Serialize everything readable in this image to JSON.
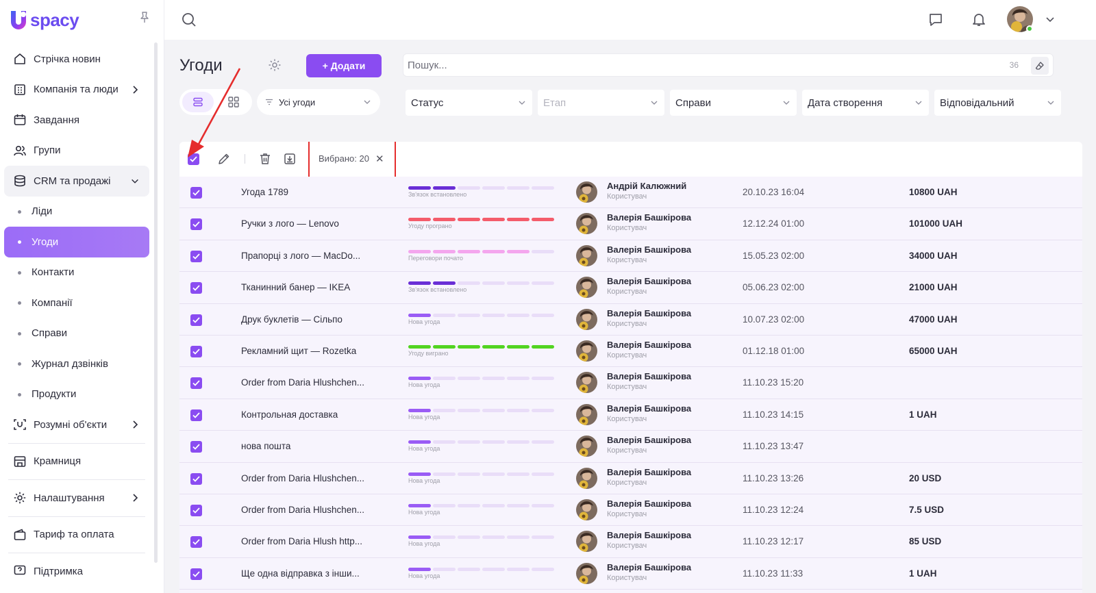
{
  "app": {
    "logo_text": "spacy",
    "logo_letter": "U"
  },
  "sidebar": {
    "items": [
      {
        "label": "Стрічка новин",
        "icon": "home-icon",
        "chevron": false
      },
      {
        "label": "Компанія та люди",
        "icon": "company-icon",
        "chevron": true
      },
      {
        "label": "Завдання",
        "icon": "calendar-icon",
        "chevron": false
      },
      {
        "label": "Групи",
        "icon": "groups-icon",
        "chevron": false
      },
      {
        "label": "CRM та продажі",
        "icon": "crm-icon",
        "chevron": true,
        "open": true
      }
    ],
    "sub_items": [
      {
        "label": "Ліди",
        "active": false
      },
      {
        "label": "Угоди",
        "active": true
      },
      {
        "label": "Контакти",
        "active": false
      },
      {
        "label": "Компанії",
        "active": false
      },
      {
        "label": "Справи",
        "active": false
      },
      {
        "label": "Журнал дзвінків",
        "active": false
      },
      {
        "label": "Продукти",
        "active": false
      }
    ],
    "bottom_items": [
      {
        "label": "Розумні об'єкти",
        "icon": "smart-objects-icon",
        "chevron": true
      },
      {
        "label": "Крамниця",
        "icon": "store-icon",
        "chevron": false
      },
      {
        "label": "Налаштування",
        "icon": "settings-icon",
        "chevron": true
      },
      {
        "label": "Тариф та оплата",
        "icon": "wallet-icon",
        "chevron": false
      },
      {
        "label": "Підтримка",
        "icon": "support-icon",
        "chevron": false
      }
    ]
  },
  "header": {
    "page_title": "Угоди",
    "add_button": "+ Додати",
    "search_placeholder": "Пошук...",
    "search_count": "36",
    "deals_filter": "Усі угоди",
    "filters": [
      "Статус",
      "Етап",
      "Справи",
      "Дата створення",
      "Відповідальний"
    ]
  },
  "toolbar": {
    "selected_text": "Вибрано: 20",
    "clear_symbol": "✕"
  },
  "colors": {
    "accent": "#8a4cf1",
    "stage_connected": "#6a2fd6",
    "stage_lost": "#f45c6b",
    "stage_negotiation": "#f4a6ee",
    "stage_new": "#9a5cf5",
    "stage_won": "#52d421",
    "annotation_red": "#e52d2d"
  },
  "deals": [
    {
      "name": "Угода 1789",
      "stage_label": "Зв'язок встановлено",
      "stage_kind": "connected",
      "stage_filled": 2,
      "owner": "Андрій Калюжний",
      "role": "Користувач",
      "date": "20.10.23 16:04",
      "amount": "10800 UAH"
    },
    {
      "name": "Ручки з лого — Lenovo",
      "stage_label": "Угоду програно",
      "stage_kind": "lost",
      "stage_filled": 6,
      "owner": "Валерія Башкірова",
      "role": "Користувач",
      "date": "12.12.24 01:00",
      "amount": "101000 UAH"
    },
    {
      "name": "Прапорці з лого — MacDo...",
      "stage_label": "Переговори почато",
      "stage_kind": "negotiation",
      "stage_filled": 5,
      "owner": "Валерія Башкірова",
      "role": "Користувач",
      "date": "15.05.23 02:00",
      "amount": "34000 UAH"
    },
    {
      "name": "Тканинний банер — IKEA",
      "stage_label": "Зв'язок встановлено",
      "stage_kind": "connected",
      "stage_filled": 2,
      "owner": "Валерія Башкірова",
      "role": "Користувач",
      "date": "05.06.23 02:00",
      "amount": "21000 UAH"
    },
    {
      "name": "Друк буклетів — Сільпо",
      "stage_label": "Нова угода",
      "stage_kind": "new",
      "stage_filled": 1,
      "owner": "Валерія Башкірова",
      "role": "Користувач",
      "date": "10.07.23 02:00",
      "amount": "47000 UAH"
    },
    {
      "name": "Рекламний щит — Rozetka",
      "stage_label": "Угоду виграно",
      "stage_kind": "won",
      "stage_filled": 6,
      "owner": "Валерія Башкірова",
      "role": "Користувач",
      "date": "01.12.18 01:00",
      "amount": "65000 UAH"
    },
    {
      "name": "Order from Daria Hlushchen...",
      "stage_label": "Нова угода",
      "stage_kind": "new",
      "stage_filled": 1,
      "owner": "Валерія Башкірова",
      "role": "Користувач",
      "date": "11.10.23 15:20",
      "amount": ""
    },
    {
      "name": "Контрольная доставка",
      "stage_label": "Нова угода",
      "stage_kind": "new",
      "stage_filled": 1,
      "owner": "Валерія Башкірова",
      "role": "Користувач",
      "date": "11.10.23 14:15",
      "amount": "1 UAH"
    },
    {
      "name": "нова пошта",
      "stage_label": "Нова угода",
      "stage_kind": "new",
      "stage_filled": 1,
      "owner": "Валерія Башкірова",
      "role": "Користувач",
      "date": "11.10.23 13:47",
      "amount": ""
    },
    {
      "name": "Order from Daria Hlushchen...",
      "stage_label": "Нова угода",
      "stage_kind": "new",
      "stage_filled": 1,
      "owner": "Валерія Башкірова",
      "role": "Користувач",
      "date": "11.10.23 13:26",
      "amount": "20 USD"
    },
    {
      "name": "Order from Daria Hlushchen...",
      "stage_label": "Нова угода",
      "stage_kind": "new",
      "stage_filled": 1,
      "owner": "Валерія Башкірова",
      "role": "Користувач",
      "date": "11.10.23 12:24",
      "amount": "7.5 USD"
    },
    {
      "name": "Order from Daria Hlush http...",
      "stage_label": "Нова угода",
      "stage_kind": "new",
      "stage_filled": 1,
      "owner": "Валерія Башкірова",
      "role": "Користувач",
      "date": "11.10.23 12:17",
      "amount": "85 USD"
    },
    {
      "name": "Ще одна відправка з інши...",
      "stage_label": "Нова угода",
      "stage_kind": "new",
      "stage_filled": 1,
      "owner": "Валерія Башкірова",
      "role": "Користувач",
      "date": "11.10.23 11:33",
      "amount": "1 UAH"
    }
  ]
}
